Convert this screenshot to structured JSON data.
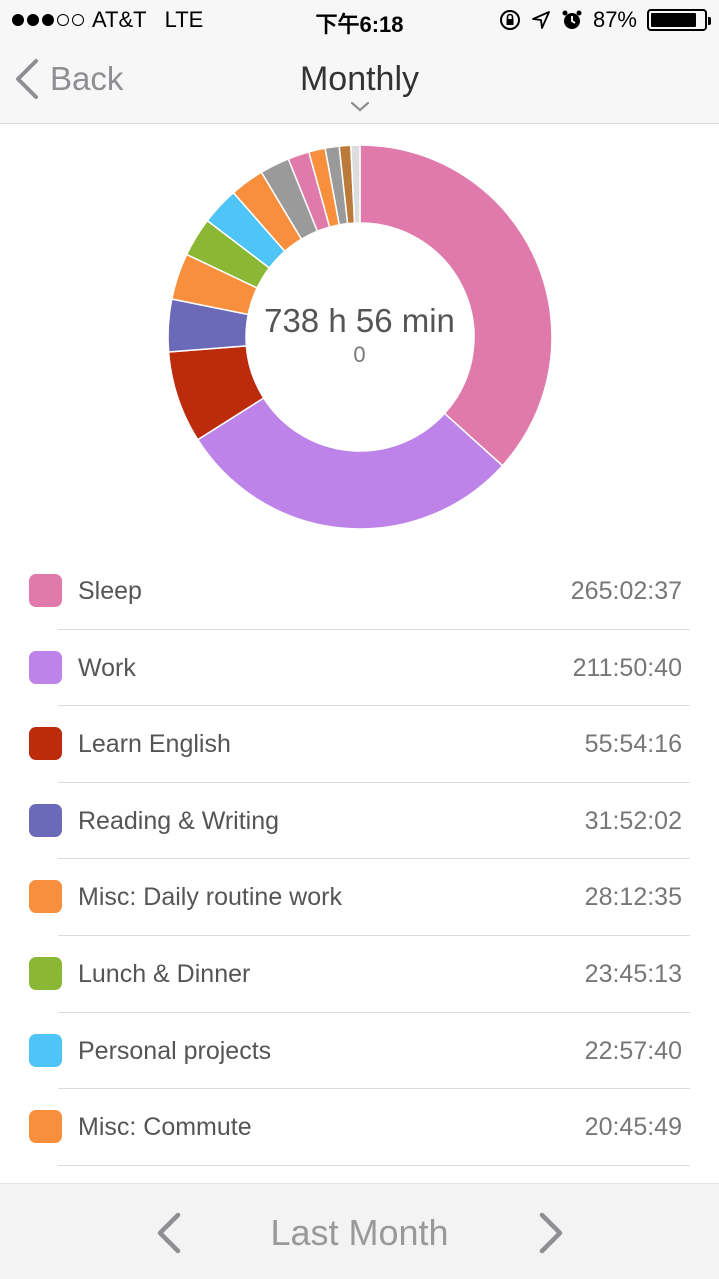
{
  "status": {
    "carrier": "AT&T",
    "network": "LTE",
    "time": "下午6:18",
    "battery": "87%",
    "battery_level": 0.87
  },
  "nav": {
    "back_label": "Back",
    "title": "Monthly"
  },
  "summary": {
    "total": "738 h 56 min",
    "sub": "0"
  },
  "activities": [
    {
      "label": "Sleep",
      "duration": "265:02:37",
      "color": "#e07aab"
    },
    {
      "label": "Work",
      "duration": "211:50:40",
      "color": "#bd83e8"
    },
    {
      "label": "Learn English",
      "duration": "55:54:16",
      "color": "#bb2b0c"
    },
    {
      "label": "Reading & Writing",
      "duration": "31:52:02",
      "color": "#6b6ab8"
    },
    {
      "label": "Misc: Daily routine work",
      "duration": "28:12:35",
      "color": "#f88f3d"
    },
    {
      "label": "Lunch & Dinner",
      "duration": "23:45:13",
      "color": "#8ab734"
    },
    {
      "label": "Personal projects",
      "duration": "22:57:40",
      "color": "#4ec4f7"
    },
    {
      "label": "Misc: Commute",
      "duration": "20:45:49",
      "color": "#f88f3d"
    }
  ],
  "chart_data": {
    "type": "pie",
    "segments": [
      {
        "value": 265.04,
        "color": "#e07aab"
      },
      {
        "value": 211.84,
        "color": "#bd83e8"
      },
      {
        "value": 55.9,
        "color": "#bb2b0c"
      },
      {
        "value": 31.87,
        "color": "#6b6ab8"
      },
      {
        "value": 28.21,
        "color": "#f88f3d"
      },
      {
        "value": 23.75,
        "color": "#8ab734"
      },
      {
        "value": 22.96,
        "color": "#4ec4f7"
      },
      {
        "value": 20.76,
        "color": "#f88f3d"
      },
      {
        "value": 18.0,
        "color": "#9a9a9a"
      },
      {
        "value": 13.0,
        "color": "#e07aab"
      },
      {
        "value": 10.0,
        "color": "#f88f3d"
      },
      {
        "value": 8.5,
        "color": "#9a9a9a"
      },
      {
        "value": 7.0,
        "color": "#bc7a3a"
      },
      {
        "value": 5.5,
        "color": "#dddddd"
      }
    ]
  },
  "footer": {
    "period": "Last Month"
  }
}
